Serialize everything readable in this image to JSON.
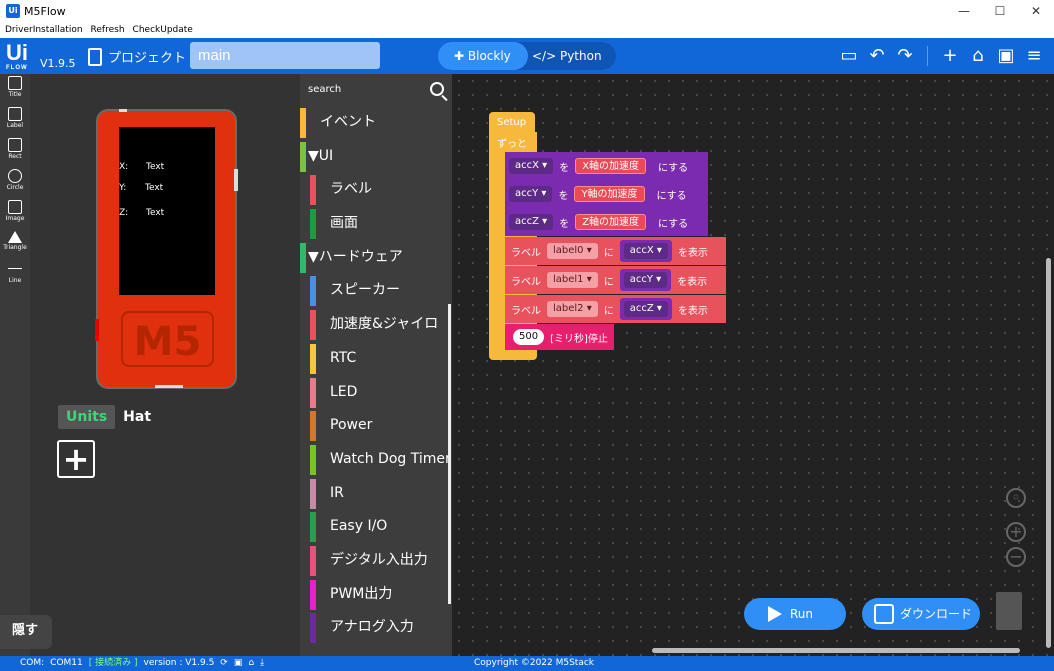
{
  "window": {
    "title": "M5Flow",
    "app_icon": "Ui",
    "controls": [
      "—",
      "☐",
      "✕"
    ]
  },
  "menu": [
    "DriverInstallation",
    "Refresh",
    "CheckUpdate"
  ],
  "header": {
    "version": "V1.9.5",
    "project_label": "プロジェクト",
    "filename": "main",
    "tab_blockly": "Blockly",
    "tab_python": "Python"
  },
  "tools": [
    {
      "label": "Title"
    },
    {
      "label": "Label"
    },
    {
      "label": "Rect"
    },
    {
      "label": "Circle"
    },
    {
      "label": "Image"
    },
    {
      "label": "Triangle"
    },
    {
      "label": "Line"
    }
  ],
  "screen": {
    "rows": [
      {
        "key": "X:",
        "value": "Text"
      },
      {
        "key": "Y:",
        "value": "Text"
      },
      {
        "key": "Z:",
        "value": "Text"
      }
    ],
    "device_logo": "M5"
  },
  "units_tabs": {
    "units": "Units",
    "hat": "Hat"
  },
  "hide_label": "隠す",
  "categories": {
    "search_placeholder": "search",
    "items": [
      {
        "label": "イベント",
        "color": "#f6b93b",
        "level": "top"
      },
      {
        "label": "▼UI",
        "color": "#7bc142",
        "level": "head"
      },
      {
        "label": "ラベル",
        "color": "#e8525c",
        "level": "sub"
      },
      {
        "label": "画面",
        "color": "#1c9c3c",
        "level": "sub"
      },
      {
        "label": "▼ハードウェア",
        "color": "#2fba6c",
        "level": "head"
      },
      {
        "label": "スピーカー",
        "color": "#4a90e2",
        "level": "sub"
      },
      {
        "label": "加速度&ジャイロ",
        "color": "#e8525c",
        "level": "sub"
      },
      {
        "label": "RTC",
        "color": "#f5c542",
        "level": "sub"
      },
      {
        "label": "LED",
        "color": "#e87b89",
        "level": "sub"
      },
      {
        "label": "Power",
        "color": "#d0782f",
        "level": "sub"
      },
      {
        "label": "Watch Dog Timer",
        "color": "#73c623",
        "level": "sub"
      },
      {
        "label": "IR",
        "color": "#c88aa6",
        "level": "sub"
      },
      {
        "label": "Easy I/O",
        "color": "#2a9e4d",
        "level": "sub"
      },
      {
        "label": "デジタル入出力",
        "color": "#e8527a",
        "level": "sub"
      },
      {
        "label": "PWM出力",
        "color": "#e81fcb",
        "level": "sub"
      },
      {
        "label": "アナログ入力",
        "color": "#6b2b9e",
        "level": "sub"
      }
    ]
  },
  "blocks": {
    "setup": "Setup",
    "forever": "ずっと",
    "assign_word": "を",
    "assign_suffix": "にする",
    "assigns": [
      {
        "var": "accX ▾",
        "value": "X軸の加速度"
      },
      {
        "var": "accY ▾",
        "value": "Y軸の加速度"
      },
      {
        "var": "accZ ▾",
        "value": "Z軸の加速度"
      }
    ],
    "label_word": "ラベル",
    "label_ni": "に",
    "label_show": "を表示",
    "labels": [
      {
        "label": "label0 ▾",
        "var": "accX ▾"
      },
      {
        "label": "label1 ▾",
        "var": "accY ▾"
      },
      {
        "label": "label2 ▾",
        "var": "accZ ▾"
      }
    ],
    "wait_value": "500",
    "wait_text": "[ミリ秒]停止"
  },
  "buttons": {
    "run": "Run",
    "download": "ダウンロード"
  },
  "status": {
    "com_label": "COM:",
    "com_port": "COM11",
    "connection": "[ 接続済み ]",
    "version": "version : V1.9.5",
    "copyright": "Copyright ©2022 M5Stack"
  }
}
